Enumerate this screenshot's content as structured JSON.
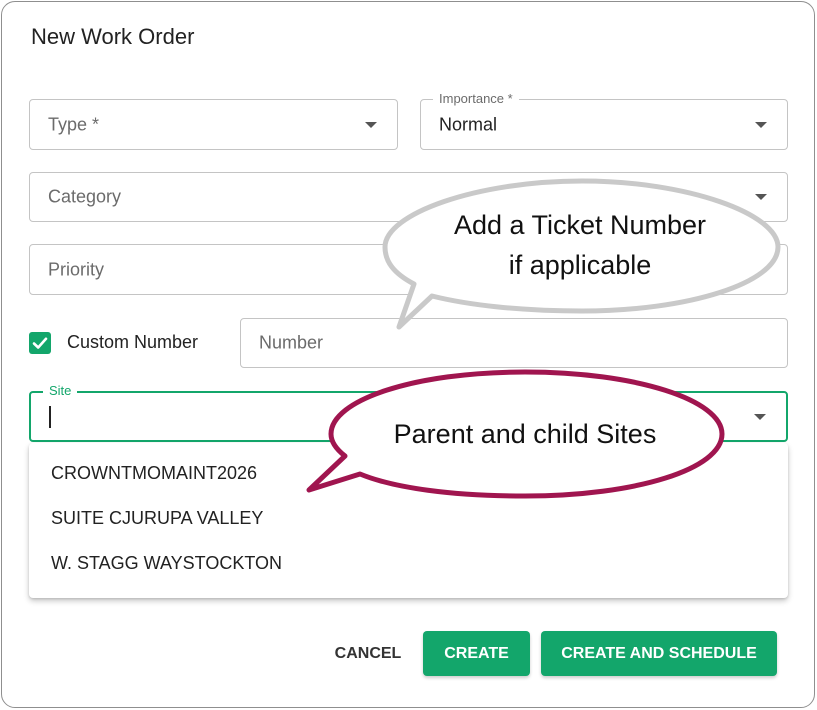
{
  "dialog": {
    "title": "New Work Order"
  },
  "fields": {
    "type": {
      "placeholder": "Type *"
    },
    "importance": {
      "label": "Importance *",
      "value": "Normal"
    },
    "category": {
      "placeholder": "Category"
    },
    "priority": {
      "placeholder": "Priority"
    },
    "custom_number": {
      "label": "Custom Number",
      "checked": true
    },
    "number": {
      "placeholder": "Number"
    },
    "site": {
      "label": "Site",
      "value": ""
    }
  },
  "site_options": [
    "CROWNTMOMAINT2026",
    "SUITE CJURUPA VALLEY",
    "W. STAGG WAYSTOCKTON"
  ],
  "buttons": {
    "cancel": "CANCEL",
    "create": "CREATE",
    "create_and_schedule": "CREATE AND SCHEDULE"
  },
  "callouts": {
    "ticket_line1": "Add a Ticket Number",
    "ticket_line2": "if applicable",
    "sites": "Parent and child Sites"
  },
  "colors": {
    "accent": "#13a66b",
    "callout_ticket_border": "#c9c9c9",
    "callout_sites_border": "#a0154f"
  },
  "icons": {
    "checkbox": "check-icon",
    "dropdown": "chevron-down-icon"
  }
}
